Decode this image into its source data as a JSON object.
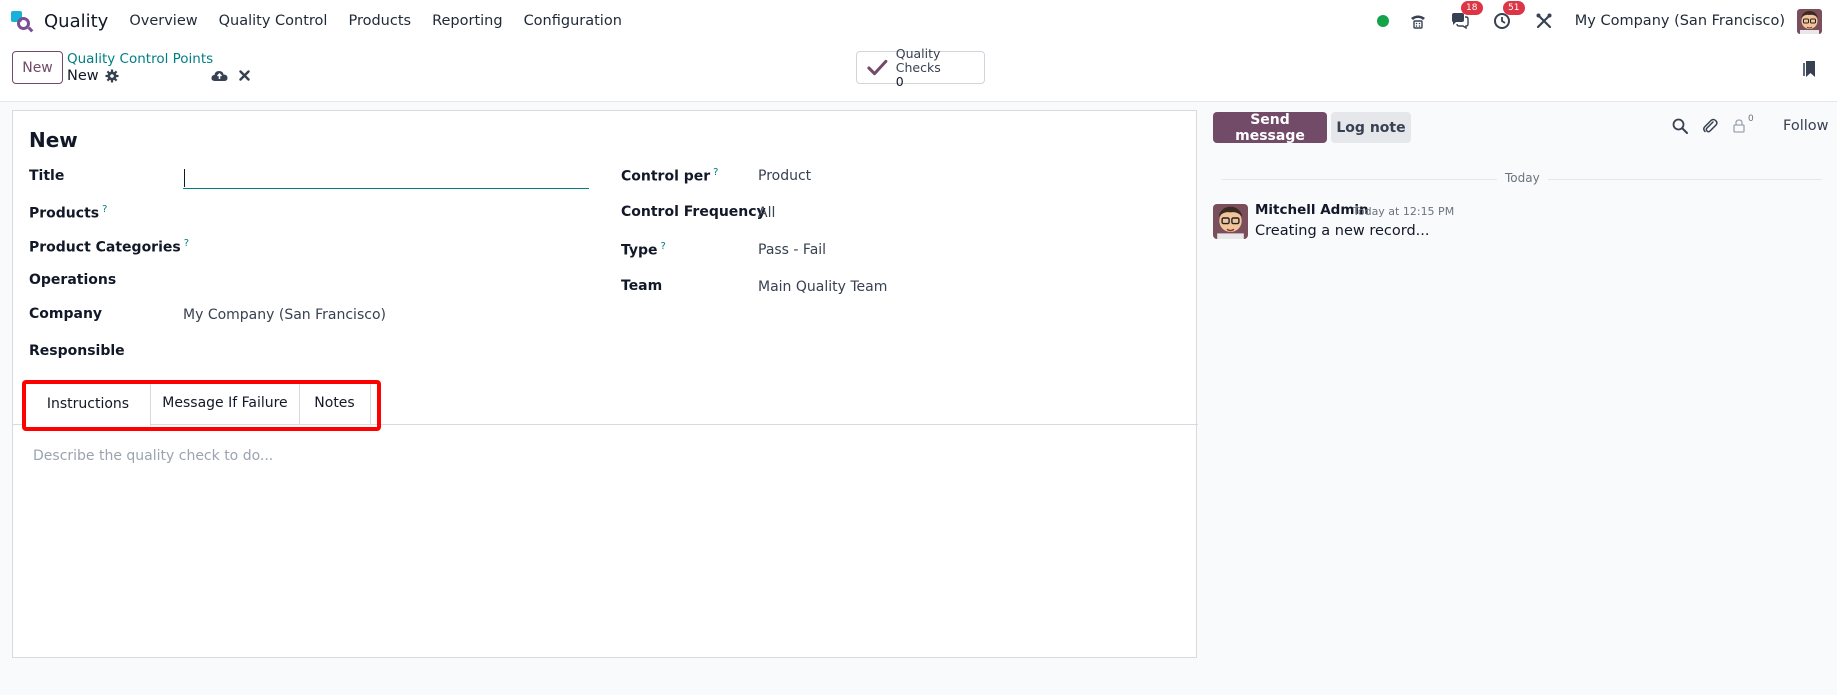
{
  "app": {
    "name": "Quality",
    "menu": [
      "Overview",
      "Quality Control",
      "Products",
      "Reporting",
      "Configuration"
    ],
    "badges": {
      "messages": "18",
      "activities": "51"
    },
    "company": "My Company (San Francisco)",
    "status_color": "#15a34a"
  },
  "control_panel": {
    "new_button": "New",
    "breadcrumb": "Quality Control Points",
    "record_name": "New",
    "smart_button": {
      "label": "Quality Checks",
      "value": "0"
    }
  },
  "form": {
    "title": "New",
    "left_fields": [
      {
        "label": "Title",
        "help": "",
        "value": ""
      },
      {
        "label": "Products",
        "help": "?",
        "value": ""
      },
      {
        "label": "Product Categories",
        "help": "?",
        "value": ""
      },
      {
        "label": "Operations",
        "help": "",
        "value": ""
      },
      {
        "label": "Company",
        "help": "",
        "value": "My Company (San Francisco)"
      },
      {
        "label": "Responsible",
        "help": "",
        "value": ""
      }
    ],
    "right_fields": [
      {
        "label": "Control per",
        "help": "?",
        "value": "Product"
      },
      {
        "label": "Control Frequency",
        "help": "",
        "value": "All"
      },
      {
        "label": "Type",
        "help": "?",
        "value": "Pass - Fail"
      },
      {
        "label": "Team",
        "help": "",
        "value": "Main Quality Team"
      }
    ],
    "tabs": [
      "Instructions",
      "Message If Failure",
      "Notes"
    ],
    "active_tab": "Instructions",
    "instructions_placeholder": "Describe the quality check to do..."
  },
  "chatter": {
    "send_message": "Send message",
    "log_note": "Log note",
    "follower_count": "0",
    "follow": "Follow",
    "date_divider": "Today",
    "messages": [
      {
        "author": "Mitchell Admin",
        "time": "Today at 12:15 PM",
        "body": "Creating a new record..."
      }
    ]
  },
  "colors": {
    "primary": "#714b67",
    "link": "#017e84",
    "highlight": "#ff0000",
    "badge": "#dc3545"
  }
}
